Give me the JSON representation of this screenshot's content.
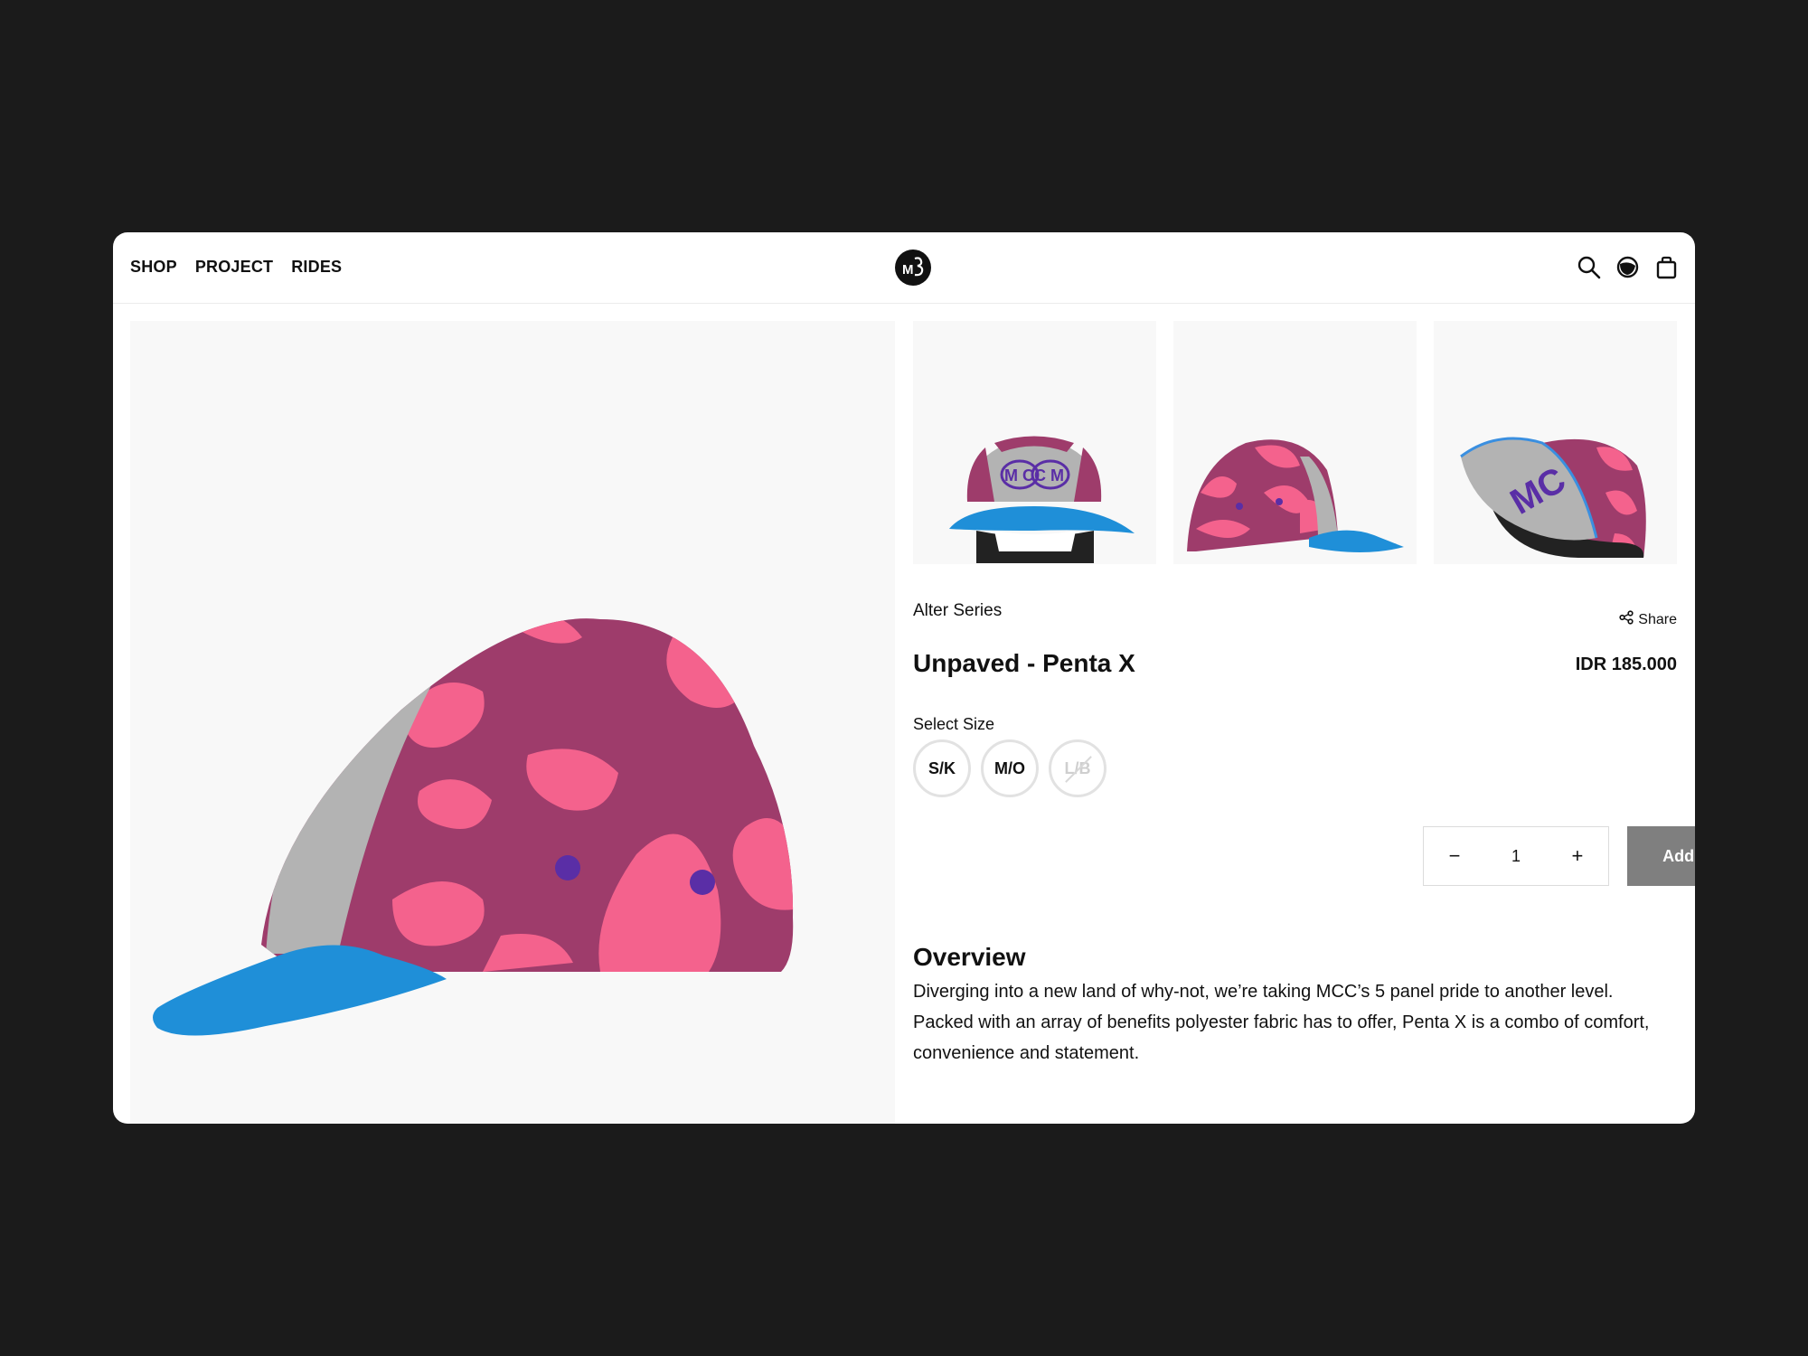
{
  "nav": {
    "items": [
      "SHOP",
      "PROJECT",
      "RIDES"
    ]
  },
  "header": {
    "logo_icon": "mcc-logo-icon",
    "icons": [
      "search-icon",
      "account-icon",
      "bag-icon"
    ]
  },
  "product": {
    "series": "Alter Series",
    "title": "Unpaved - Penta X",
    "price": "IDR 185.000",
    "share_label": "Share",
    "thumb_logo_text": "M CC M",
    "size_label": "Select Size",
    "sizes": [
      {
        "label": "S/K",
        "available": true
      },
      {
        "label": "M/O",
        "available": true
      },
      {
        "label": "L/B",
        "available": false
      }
    ],
    "quantity": "1",
    "minus": "−",
    "plus": "+",
    "add_to_cart": "Add To Cart",
    "overview_title": "Overview",
    "overview_text": "Diverging into a new land of why-not, we’re taking MCC’s 5 panel pride to another level. Packed with an array of benefits polyester fabric has to offer, Penta X is a combo of comfort, convenience and statement."
  },
  "colors": {
    "cap_base": "#9e3c6b",
    "cap_pink": "#f4628d",
    "cap_grey": "#b3b3b3",
    "cap_brim": "#1f8fd8",
    "accent_purple": "#5a2ea6",
    "cart_button": "#7f7f7f"
  }
}
